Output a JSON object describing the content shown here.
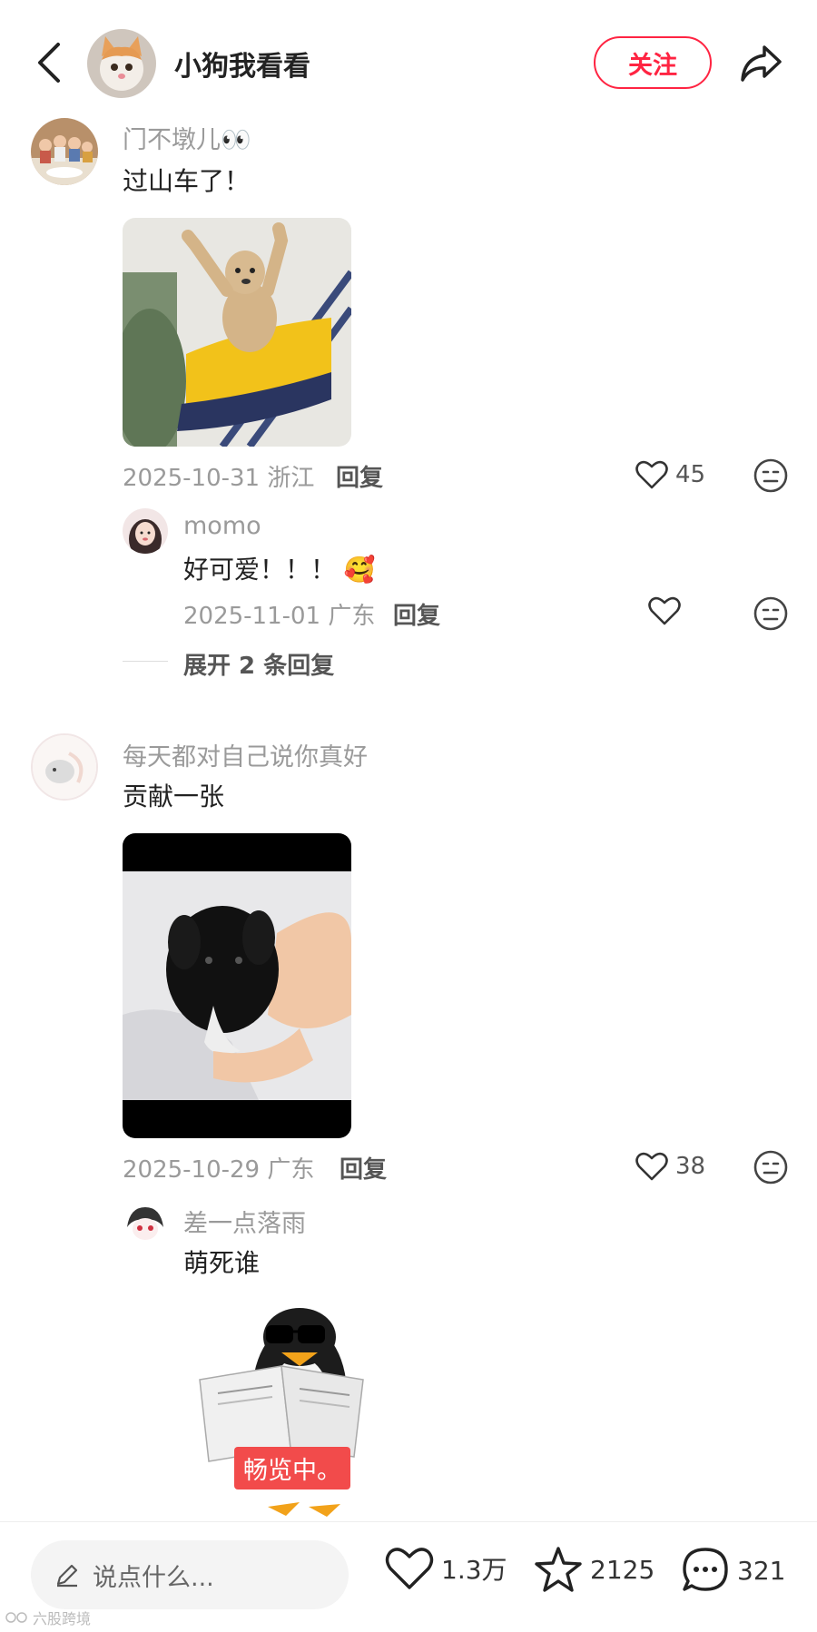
{
  "header": {
    "title": "小狗我看看",
    "follow_label": "关注"
  },
  "comments": [
    {
      "user": "门不墩儿👀",
      "text": "过山车了！",
      "date_loc": "2025-10-31 浙江",
      "reply_label": "回复",
      "likes": "45",
      "replies": [
        {
          "user": "momo",
          "text": "好可爱！！！ 🥰",
          "date_loc": "2025-11-01 广东",
          "reply_label": "回复"
        }
      ],
      "expand_label": "展开 2 条回复"
    },
    {
      "user": "每天都对自己说你真好",
      "text": "贡献一张",
      "date_loc": "2025-10-29 广东",
      "reply_label": "回复",
      "likes": "38",
      "replies": [
        {
          "user": "差一点落雨",
          "text": "萌死谁",
          "sticker_caption": "畅览中。"
        }
      ]
    }
  ],
  "bottom_bar": {
    "input_placeholder": "说点什么...",
    "likes": "1.3万",
    "favorites": "2125",
    "comments": "321"
  },
  "watermark": "六股跨境",
  "colors": {
    "accent": "#ff2442",
    "text_primary": "#222222",
    "text_secondary": "#9a9a9a"
  }
}
